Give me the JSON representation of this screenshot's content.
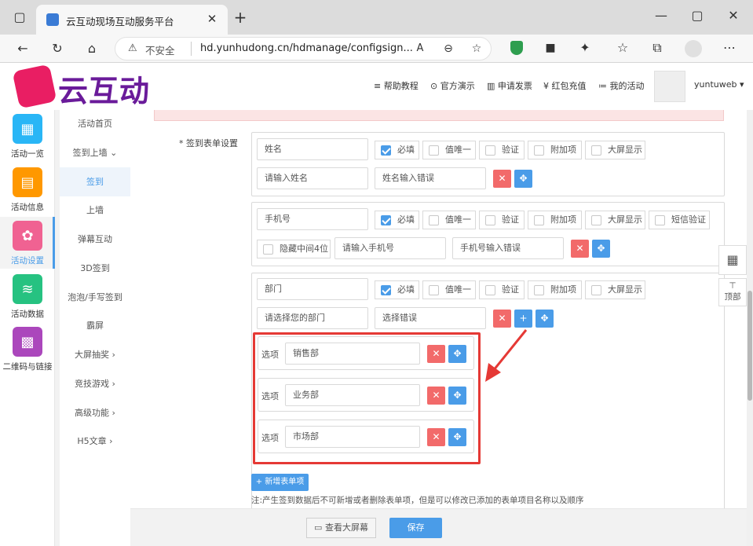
{
  "browser": {
    "tab_title": "云互动现场互动服务平台",
    "insecure_label": "不安全",
    "url": "hd.yunhudong.cn/hdmanage/configsign..."
  },
  "header": {
    "logo_text": "云互动",
    "links": [
      "帮助教程",
      "官方演示",
      "申请发票",
      "红包充值",
      "我的活动"
    ],
    "user": "yuntuweb"
  },
  "leftnav": [
    {
      "label": "活动一览",
      "color": "#29b6f6",
      "icon": "grid-icon"
    },
    {
      "label": "活动信息",
      "color": "#ff9800",
      "icon": "document-icon"
    },
    {
      "label": "活动设置",
      "color": "#f06292",
      "icon": "gear-icon"
    },
    {
      "label": "活动数据",
      "color": "#26c281",
      "icon": "database-icon"
    },
    {
      "label": "二维码与链接",
      "color": "#ab47bc",
      "icon": "qrcode-icon"
    }
  ],
  "subnav": [
    "活动首页",
    "签到上墙",
    "签到",
    "上墙",
    "弹幕互动",
    "3D签到",
    "泡泡/手写签到",
    "霸屏",
    "大屏抽奖",
    "竞技游戏",
    "高级功能",
    "H5文章"
  ],
  "form": {
    "section_label": "* 签到表单设置",
    "check_required": "必填",
    "check_unique": "值唯一",
    "check_verify": "验证",
    "check_extra": "附加项",
    "check_screen": "大屏显示",
    "check_sms": "短信验证",
    "check_hide_mid": "隐藏中间4位",
    "field1": {
      "name": "姓名",
      "placeholder": "请输入姓名",
      "error": "姓名输入错误"
    },
    "field2": {
      "name": "手机号",
      "placeholder": "请输入手机号",
      "error": "手机号输入错误"
    },
    "field3": {
      "name": "部门",
      "placeholder": "请选择您的部门",
      "error": "选择错误"
    },
    "option_label": "选项",
    "options": [
      "销售部",
      "业务部",
      "市场部"
    ],
    "add_item": "+ 新增表单项",
    "note": "注:产生签到数据后不可新增或者删除表单项，但是可以修改已添加的表单项目名称以及顺序"
  },
  "side_tools": {
    "top_label": "顶部"
  },
  "footer": {
    "preview": "查看大屏幕",
    "save": "保存"
  },
  "colors": {
    "accent": "#4a9ce8",
    "danger": "#f26a6a",
    "highlight": "#e53935"
  }
}
